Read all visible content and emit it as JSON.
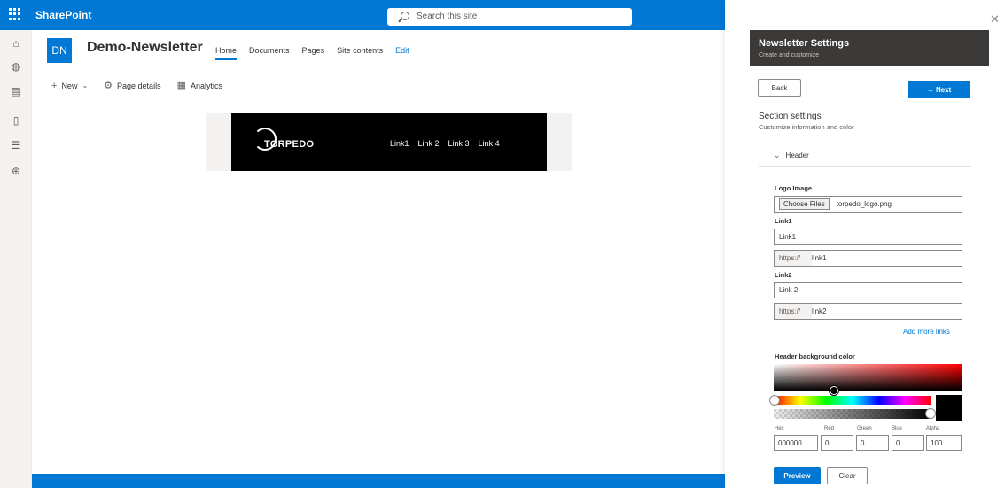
{
  "suitebar": {
    "brand": "SharePoint",
    "search_placeholder": "Search this site"
  },
  "rail": {
    "icons": [
      "home-icon",
      "globe-icon",
      "news-icon",
      "document-icon",
      "list-icon",
      "add-circle-icon"
    ]
  },
  "site": {
    "logo_initials": "DN",
    "title": "Demo-Newsletter",
    "nav": [
      "Home",
      "Documents",
      "Pages",
      "Site contents"
    ],
    "nav_edit": "Edit"
  },
  "commandbar": {
    "new": "New",
    "page_details": "Page details",
    "analytics": "Analytics"
  },
  "newsletter_preview": {
    "logo_text": "TORPEDO",
    "links": [
      "Link1",
      "Link 2",
      "Link 3",
      "Link 4"
    ],
    "background_color": "#000000"
  },
  "panel": {
    "title": "Newsletter Settings",
    "subtitle": "Create and customize",
    "back_label": "Back",
    "next_label": "→  Next",
    "section_title": "Section settings",
    "section_subtitle": "Customize information and color",
    "accordion_label": "Header",
    "logo_label": "Logo Image",
    "choose_files_label": "Choose Files",
    "file_name": "torpedo_logo.png",
    "link1_label": "Link1",
    "link1_text": "Link1",
    "link1_prefix": "https://",
    "link1_url": "link1",
    "link2_label": "Link2",
    "link2_text": "Link 2",
    "link2_prefix": "https://",
    "link2_url": "link2",
    "add_more_links": "Add more links",
    "bg_color_label": "Header background color",
    "color": {
      "hex_label": "Hex",
      "red_label": "Red",
      "green_label": "Green",
      "blue_label": "Blue",
      "alpha_label": "Alpha",
      "hex": "000000",
      "red": "0",
      "green": "0",
      "blue": "0",
      "alpha": "100"
    },
    "preview_label": "Preview",
    "clear_label": "Clear"
  },
  "colors": {
    "accent": "#0078d4",
    "panel_header": "#3b3a39"
  }
}
